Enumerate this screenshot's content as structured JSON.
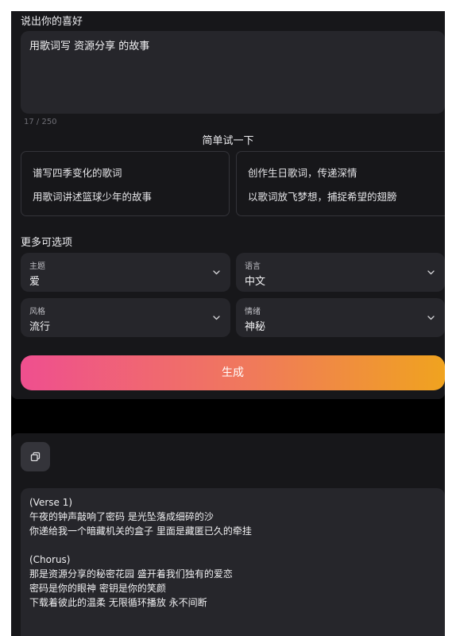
{
  "prompt": {
    "label": "说出你的喜好",
    "value": "用歌词写 资源分享 的故事",
    "char_count": "17 / 250"
  },
  "suggestions": {
    "title": "简单试一下",
    "left": [
      "谱写四季变化的歌词",
      "用歌词讲述篮球少年的故事"
    ],
    "right": [
      "创作生日歌词，传递深情",
      "以歌词放飞梦想，捕捉希望的翅膀"
    ]
  },
  "options": {
    "title": "更多可选项",
    "theme": {
      "label": "主题",
      "value": "爱"
    },
    "language": {
      "label": "语言",
      "value": "中文"
    },
    "style": {
      "label": "风格",
      "value": "流行"
    },
    "mood": {
      "label": "情绪",
      "value": "神秘"
    }
  },
  "generate_label": "生成",
  "icons": {
    "copy": "copy-icon",
    "chevron": "chevron-down-icon"
  },
  "colors": {
    "accent_start": "#ef4f8f",
    "accent_end": "#f0a31f",
    "panel": "#17171a",
    "field": "#26262b"
  },
  "lyrics": {
    "verse_title": "(Verse 1)",
    "verse": [
      "午夜的钟声敲响了密码  是光坠落成细碎的沙",
      "你递给我一个暗藏机关的盒子  里面是藏匿已久的牵挂"
    ],
    "chorus_title": "(Chorus)",
    "chorus": [
      "那是资源分享的秘密花园  盛开着我们独有的爱恋",
      "密码是你的眼神  密钥是你的笑颜",
      "下载着彼此的温柔  无限循环播放  永不间断"
    ]
  }
}
